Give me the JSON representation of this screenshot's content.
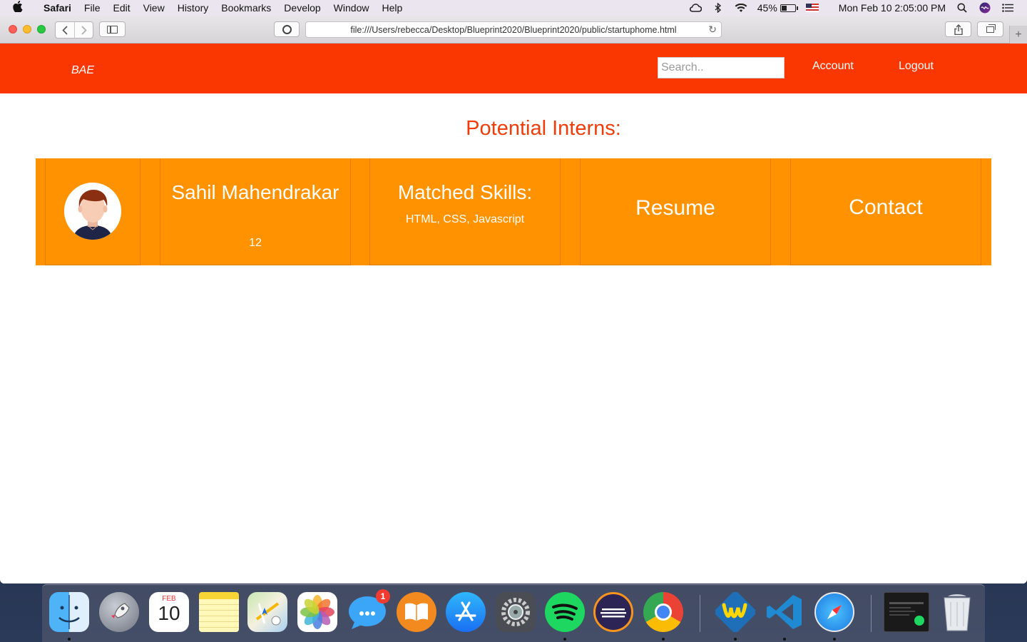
{
  "menubar": {
    "app_name": "Safari",
    "items": [
      "File",
      "Edit",
      "View",
      "History",
      "Bookmarks",
      "Develop",
      "Window",
      "Help"
    ],
    "battery_percent": "45%",
    "battery_level": 0.45,
    "datetime": "Mon Feb 10  2:05:00 PM"
  },
  "browser": {
    "url": "file:///Users/rebecca/Desktop/Blueprint2020/Blueprint2020/public/startuphome.html"
  },
  "site": {
    "brand": "BAE",
    "search_placeholder": "Search..",
    "nav": {
      "account": "Account",
      "logout": "Logout"
    },
    "colors": {
      "navbar": "#fa3700",
      "strip": "#ff9200",
      "title": "#f03c08"
    }
  },
  "main": {
    "title": "Potential Interns:",
    "intern": {
      "name": "Sahil Mahendrakar",
      "number": "12",
      "skills_heading": "Matched Skills:",
      "skills": "HTML, CSS, Javascript",
      "resume_label": "Resume",
      "contact_label": "Contact"
    }
  },
  "dock": {
    "apps": [
      {
        "name": "Finder",
        "icon": "finder-icon",
        "running": true
      },
      {
        "name": "Launchpad",
        "icon": "launchpad-icon",
        "running": false
      },
      {
        "name": "Calendar",
        "icon": "calendar-icon",
        "running": false,
        "month": "FEB",
        "day": "10"
      },
      {
        "name": "Notes",
        "icon": "notes-icon",
        "running": false
      },
      {
        "name": "Maps",
        "icon": "maps-icon",
        "running": false
      },
      {
        "name": "Photos",
        "icon": "photos-icon",
        "running": false
      },
      {
        "name": "Messages",
        "icon": "messages-icon",
        "running": false,
        "badge": "1"
      },
      {
        "name": "Books",
        "icon": "books-icon",
        "running": false
      },
      {
        "name": "App Store",
        "icon": "app-store-icon",
        "running": false
      },
      {
        "name": "System Preferences",
        "icon": "system-preferences-icon",
        "running": false
      },
      {
        "name": "Spotify",
        "icon": "spotify-icon",
        "running": true
      },
      {
        "name": "Eclipse",
        "icon": "eclipse-icon",
        "running": false
      },
      {
        "name": "Chrome",
        "icon": "chrome-icon",
        "running": true
      },
      {
        "name": "WinZip",
        "icon": "winzip-icon",
        "running": true
      },
      {
        "name": "VS Code",
        "icon": "vscode-icon",
        "running": true
      },
      {
        "name": "Safari",
        "icon": "safari-icon",
        "running": true
      },
      {
        "name": "Spotify Window",
        "icon": "spotify-window-icon",
        "running": false
      },
      {
        "name": "Trash",
        "icon": "trash-icon",
        "running": false
      }
    ]
  }
}
